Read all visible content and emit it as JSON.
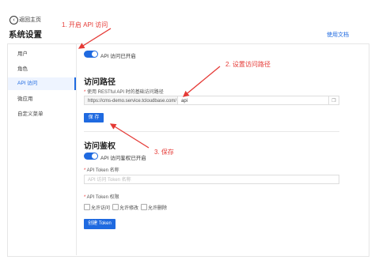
{
  "header": {
    "back_label": "返回主页",
    "page_title": "系统设置",
    "docs_link": "使用文档"
  },
  "sidebar": {
    "items": [
      {
        "label": "用户"
      },
      {
        "label": "角色"
      },
      {
        "label": "API 访问"
      },
      {
        "label": "微应用"
      },
      {
        "label": "自定义菜单"
      }
    ],
    "active_index": 2
  },
  "api_access": {
    "toggle_label": "API 访问已开启",
    "enabled": true
  },
  "access_path": {
    "title": "访问路径",
    "field_label": "使用 RESTful API 时的基础访问路径",
    "url_prefix": "https://cms-demo.service.tcloudbase.com/",
    "path_value": "api",
    "save_label": "保 存"
  },
  "access_auth": {
    "title": "访问鉴权",
    "toggle_label": "API 访问鉴权已开启",
    "enabled": true,
    "token_name_label": "API Token 名称",
    "token_name_placeholder": "API 访问 Token 名称",
    "permission_label": "API Token 权限",
    "permissions": [
      {
        "label": "允许访问",
        "checked": false
      },
      {
        "label": "允许修改",
        "checked": false
      },
      {
        "label": "允许删除",
        "checked": false
      }
    ],
    "create_label": "创建 Token"
  },
  "annotations": {
    "step1": "1. 开启 API 访问",
    "step2": "2. 设置访问路径",
    "step3": "3. 保存"
  },
  "colors": {
    "primary": "#1f6ae0",
    "annotation": "#e53935",
    "active_bg": "#eef4ff"
  }
}
